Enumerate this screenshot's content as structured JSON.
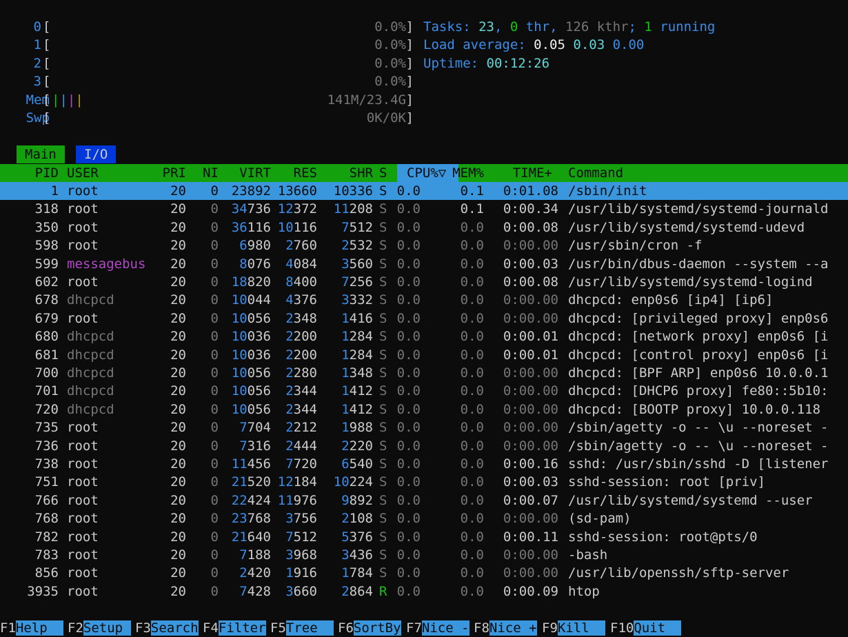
{
  "meters": {
    "cpus": [
      {
        "label": "0",
        "value": "0.0%"
      },
      {
        "label": "1",
        "value": "0.0%"
      },
      {
        "label": "2",
        "value": "0.0%"
      },
      {
        "label": "3",
        "value": "0.0%"
      }
    ],
    "mem": {
      "label": "Mem",
      "value": "141M/23.4G"
    },
    "swp": {
      "label": "Swp",
      "value": "0K/0K"
    }
  },
  "info": {
    "tasks_label": "Tasks: ",
    "tasks": "23",
    "thr": "0",
    "thr_label": " thr",
    "kthr": "126 kthr",
    "running": "1",
    "running_label": " running",
    "load_label": "Load average: ",
    "load1": "0.05",
    "load5": "0.03",
    "load15": "0.00",
    "uptime_label": "Uptime: ",
    "uptime": "00:12:26"
  },
  "tabs": [
    "Main",
    "I/O"
  ],
  "columns": {
    "pid": "PID",
    "user": "USER",
    "pri": "PRI",
    "ni": "NI",
    "virt": "VIRT",
    "res": "RES",
    "shr": "SHR",
    "s": "S",
    "cpu": "CPU%▽",
    "mem": "MEM%",
    "time": "TIME+",
    "command": "Command"
  },
  "processes": [
    {
      "pid": "1",
      "user": "root",
      "pri": "20",
      "ni": "0",
      "virt": "23892",
      "res": "13660",
      "shr": "10336",
      "s": "S",
      "cpu": "0.0",
      "mem": "0.1",
      "time": "0:01.08",
      "cmd": "/sbin/init"
    },
    {
      "pid": "318",
      "user": "root",
      "pri": "20",
      "ni": "0",
      "virt": "34736",
      "res": "12372",
      "shr": "11208",
      "s": "S",
      "cpu": "0.0",
      "mem": "0.1",
      "time": "0:00.34",
      "cmd": "/usr/lib/systemd/systemd-journald"
    },
    {
      "pid": "350",
      "user": "root",
      "pri": "20",
      "ni": "0",
      "virt": "36116",
      "res": "10116",
      "shr": "7512",
      "s": "S",
      "cpu": "0.0",
      "mem": "0.0",
      "time": "0:00.08",
      "cmd": "/usr/lib/systemd/systemd-udevd"
    },
    {
      "pid": "598",
      "user": "root",
      "pri": "20",
      "ni": "0",
      "virt": "6980",
      "res": "2760",
      "shr": "2532",
      "s": "S",
      "cpu": "0.0",
      "mem": "0.0",
      "time": "0:00.00",
      "cmd": "/usr/sbin/cron -f"
    },
    {
      "pid": "599",
      "user": "messagebus",
      "pri": "20",
      "ni": "0",
      "virt": "8076",
      "res": "4084",
      "shr": "3560",
      "s": "S",
      "cpu": "0.0",
      "mem": "0.0",
      "time": "0:00.03",
      "cmd": "/usr/bin/dbus-daemon --system --a"
    },
    {
      "pid": "602",
      "user": "root",
      "pri": "20",
      "ni": "0",
      "virt": "18820",
      "res": "8400",
      "shr": "7256",
      "s": "S",
      "cpu": "0.0",
      "mem": "0.0",
      "time": "0:00.08",
      "cmd": "/usr/lib/systemd/systemd-logind"
    },
    {
      "pid": "678",
      "user": "dhcpcd",
      "pri": "20",
      "ni": "0",
      "virt": "10044",
      "res": "4376",
      "shr": "3332",
      "s": "S",
      "cpu": "0.0",
      "mem": "0.0",
      "time": "0:00.00",
      "cmd": "dhcpcd: enp0s6 [ip4] [ip6]"
    },
    {
      "pid": "679",
      "user": "root",
      "pri": "20",
      "ni": "0",
      "virt": "10056",
      "res": "2348",
      "shr": "1416",
      "s": "S",
      "cpu": "0.0",
      "mem": "0.0",
      "time": "0:00.00",
      "cmd": "dhcpcd: [privileged proxy] enp0s6"
    },
    {
      "pid": "680",
      "user": "dhcpcd",
      "pri": "20",
      "ni": "0",
      "virt": "10036",
      "res": "2200",
      "shr": "1284",
      "s": "S",
      "cpu": "0.0",
      "mem": "0.0",
      "time": "0:00.01",
      "cmd": "dhcpcd: [network proxy] enp0s6 [i"
    },
    {
      "pid": "681",
      "user": "dhcpcd",
      "pri": "20",
      "ni": "0",
      "virt": "10036",
      "res": "2200",
      "shr": "1284",
      "s": "S",
      "cpu": "0.0",
      "mem": "0.0",
      "time": "0:00.01",
      "cmd": "dhcpcd: [control proxy] enp0s6 [i"
    },
    {
      "pid": "700",
      "user": "dhcpcd",
      "pri": "20",
      "ni": "0",
      "virt": "10056",
      "res": "2280",
      "shr": "1348",
      "s": "S",
      "cpu": "0.0",
      "mem": "0.0",
      "time": "0:00.00",
      "cmd": "dhcpcd: [BPF ARP] enp0s6 10.0.0.1"
    },
    {
      "pid": "701",
      "user": "dhcpcd",
      "pri": "20",
      "ni": "0",
      "virt": "10056",
      "res": "2344",
      "shr": "1412",
      "s": "S",
      "cpu": "0.0",
      "mem": "0.0",
      "time": "0:00.00",
      "cmd": "dhcpcd: [DHCP6 proxy] fe80::5b10:"
    },
    {
      "pid": "720",
      "user": "dhcpcd",
      "pri": "20",
      "ni": "0",
      "virt": "10056",
      "res": "2344",
      "shr": "1412",
      "s": "S",
      "cpu": "0.0",
      "mem": "0.0",
      "time": "0:00.00",
      "cmd": "dhcpcd: [BOOTP proxy] 10.0.0.118"
    },
    {
      "pid": "735",
      "user": "root",
      "pri": "20",
      "ni": "0",
      "virt": "7704",
      "res": "2212",
      "shr": "1988",
      "s": "S",
      "cpu": "0.0",
      "mem": "0.0",
      "time": "0:00.00",
      "cmd": "/sbin/agetty -o -- \\u --noreset -"
    },
    {
      "pid": "736",
      "user": "root",
      "pri": "20",
      "ni": "0",
      "virt": "7316",
      "res": "2444",
      "shr": "2220",
      "s": "S",
      "cpu": "0.0",
      "mem": "0.0",
      "time": "0:00.00",
      "cmd": "/sbin/agetty -o -- \\u --noreset -"
    },
    {
      "pid": "738",
      "user": "root",
      "pri": "20",
      "ni": "0",
      "virt": "11456",
      "res": "7720",
      "shr": "6540",
      "s": "S",
      "cpu": "0.0",
      "mem": "0.0",
      "time": "0:00.16",
      "cmd": "sshd: /usr/sbin/sshd -D [listener"
    },
    {
      "pid": "751",
      "user": "root",
      "pri": "20",
      "ni": "0",
      "virt": "21520",
      "res": "12184",
      "shr": "10224",
      "s": "S",
      "cpu": "0.0",
      "mem": "0.0",
      "time": "0:00.03",
      "cmd": "sshd-session: root [priv]"
    },
    {
      "pid": "766",
      "user": "root",
      "pri": "20",
      "ni": "0",
      "virt": "22424",
      "res": "11976",
      "shr": "9892",
      "s": "S",
      "cpu": "0.0",
      "mem": "0.0",
      "time": "0:00.07",
      "cmd": "/usr/lib/systemd/systemd --user"
    },
    {
      "pid": "768",
      "user": "root",
      "pri": "20",
      "ni": "0",
      "virt": "23768",
      "res": "3756",
      "shr": "2108",
      "s": "S",
      "cpu": "0.0",
      "mem": "0.0",
      "time": "0:00.00",
      "cmd": "(sd-pam)"
    },
    {
      "pid": "782",
      "user": "root",
      "pri": "20",
      "ni": "0",
      "virt": "21640",
      "res": "7512",
      "shr": "5376",
      "s": "S",
      "cpu": "0.0",
      "mem": "0.0",
      "time": "0:00.11",
      "cmd": "sshd-session: root@pts/0"
    },
    {
      "pid": "783",
      "user": "root",
      "pri": "20",
      "ni": "0",
      "virt": "7188",
      "res": "3968",
      "shr": "3436",
      "s": "S",
      "cpu": "0.0",
      "mem": "0.0",
      "time": "0:00.00",
      "cmd": "-bash"
    },
    {
      "pid": "856",
      "user": "root",
      "pri": "20",
      "ni": "0",
      "virt": "2420",
      "res": "1916",
      "shr": "1784",
      "s": "S",
      "cpu": "0.0",
      "mem": "0.0",
      "time": "0:00.00",
      "cmd": "/usr/lib/openssh/sftp-server"
    },
    {
      "pid": "3935",
      "user": "root",
      "pri": "20",
      "ni": "0",
      "virt": "7428",
      "res": "3660",
      "shr": "2864",
      "s": "R",
      "cpu": "0.0",
      "mem": "0.0",
      "time": "0:00.09",
      "cmd": "htop"
    }
  ],
  "footer": [
    {
      "key": "F1",
      "label": "Help  "
    },
    {
      "key": "F2",
      "label": "Setup "
    },
    {
      "key": "F3",
      "label": "Search"
    },
    {
      "key": "F4",
      "label": "Filter"
    },
    {
      "key": "F5",
      "label": "Tree  "
    },
    {
      "key": "F6",
      "label": "SortBy"
    },
    {
      "key": "F7",
      "label": "Nice -"
    },
    {
      "key": "F8",
      "label": "Nice +"
    },
    {
      "key": "F9",
      "label": "Kill  "
    },
    {
      "key": "F10",
      "label": "Quit  "
    }
  ],
  "colors": {
    "background": "#0c0c0c",
    "header_green": "#13a10e",
    "selection_blue": "#3a96dd",
    "accent_blue": "#3b8eea",
    "accent_cyan": "#61d6d6",
    "messagebus_magenta": "#b148c6"
  }
}
